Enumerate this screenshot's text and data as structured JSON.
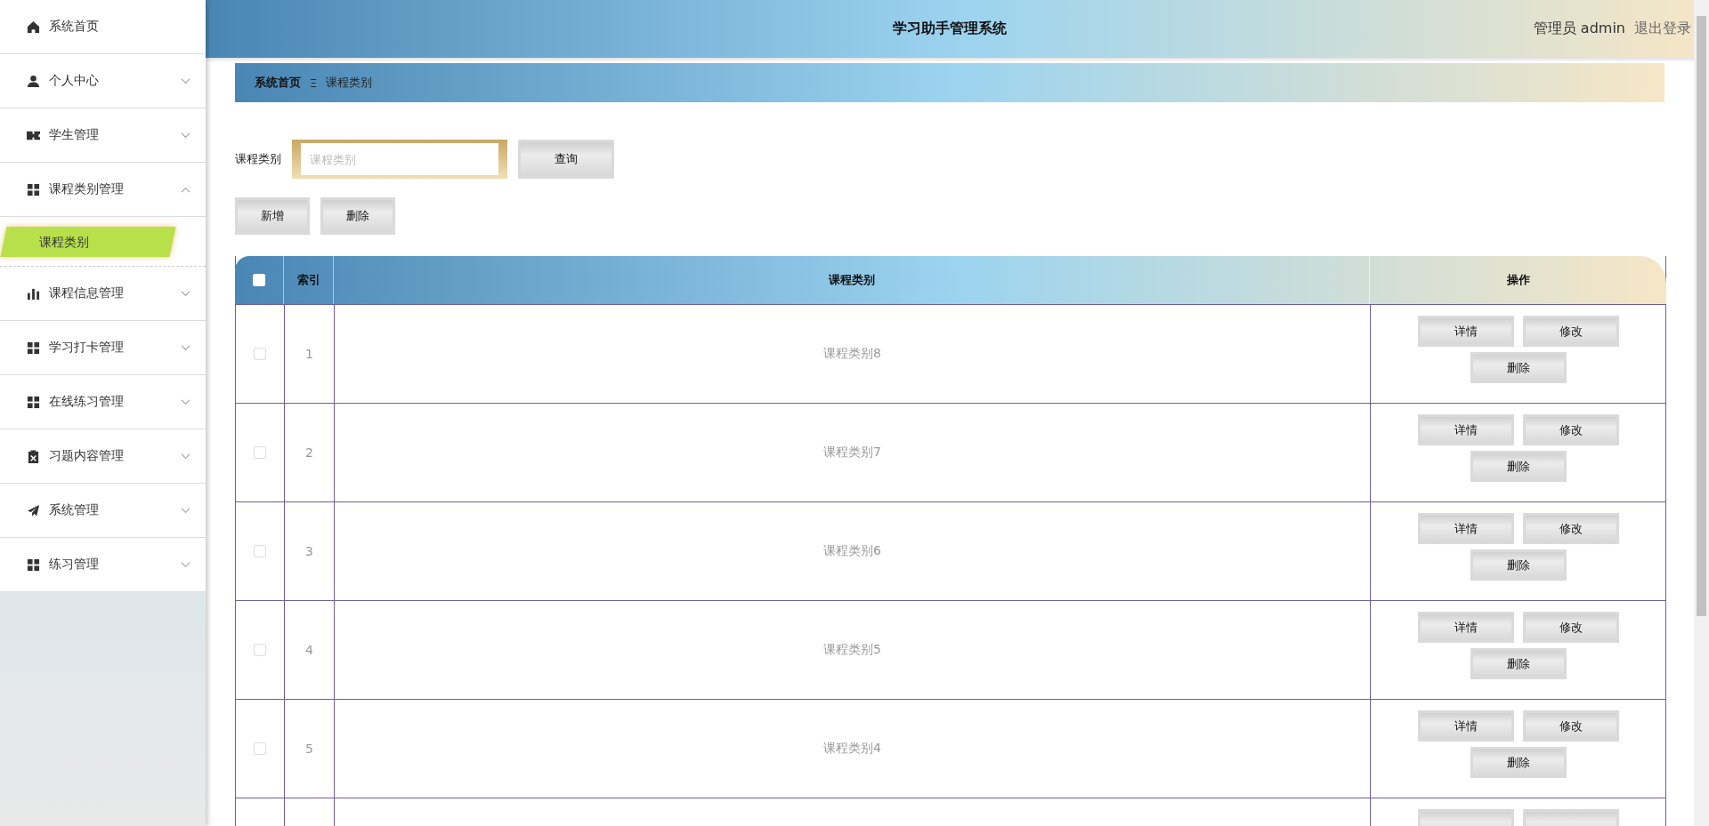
{
  "sidebar": {
    "items": [
      {
        "label": "系统首页",
        "kind": "link"
      },
      {
        "label": "个人中心",
        "kind": "menu",
        "expanded": false
      },
      {
        "label": "学生管理",
        "kind": "menu",
        "expanded": false
      },
      {
        "label": "课程类别管理",
        "kind": "menu",
        "expanded": true,
        "children": [
          {
            "label": "课程类别",
            "selected": true
          }
        ]
      },
      {
        "label": "课程信息管理",
        "kind": "menu",
        "expanded": false
      },
      {
        "label": "学习打卡管理",
        "kind": "menu",
        "expanded": false
      },
      {
        "label": "在线练习管理",
        "kind": "menu",
        "expanded": false
      },
      {
        "label": "习题内容管理",
        "kind": "menu",
        "expanded": false
      },
      {
        "label": "系统管理",
        "kind": "menu",
        "expanded": false
      },
      {
        "label": "练习管理",
        "kind": "menu",
        "expanded": false
      }
    ]
  },
  "header": {
    "title": "学习助手管理系统",
    "user": "管理员 admin",
    "logout": "退出登录"
  },
  "breadcrumb": {
    "home": "系统首页",
    "separator": "Ξ",
    "current": "课程类别"
  },
  "search": {
    "label": "课程类别",
    "placeholder": "课程类别",
    "button": "查询"
  },
  "actions": [
    "新增",
    "删除"
  ],
  "table": {
    "columns": [
      "索引",
      "课程类别",
      "操作"
    ],
    "select_all": false,
    "rows": [
      {
        "selected": false,
        "index": "1",
        "category": "课程类别8",
        "buttons": [
          "详情",
          "修改",
          "删除"
        ]
      },
      {
        "selected": false,
        "index": "2",
        "category": "课程类别7",
        "buttons": [
          "详情",
          "修改",
          "删除"
        ]
      },
      {
        "selected": false,
        "index": "3",
        "category": "课程类别6",
        "buttons": [
          "详情",
          "修改",
          "删除"
        ]
      },
      {
        "selected": false,
        "index": "4",
        "category": "课程类别5",
        "buttons": [
          "详情",
          "修改",
          "删除"
        ]
      },
      {
        "selected": false,
        "index": "5",
        "category": "课程类别4",
        "buttons": [
          "详情",
          "修改",
          "删除"
        ]
      },
      {
        "kind": "cut"
      }
    ]
  }
}
